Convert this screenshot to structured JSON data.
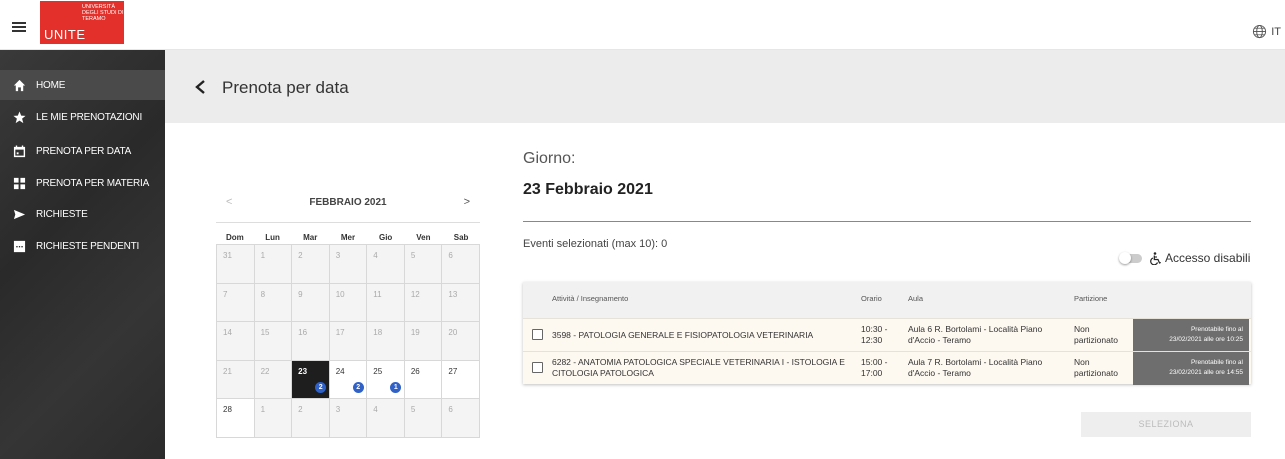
{
  "header": {
    "logo_text": "UNITE",
    "logo_subtext": "UNIVERSITÀ DEGLI STUDI DI TERAMO",
    "language": "IT"
  },
  "sidebar": {
    "items": [
      {
        "label": "HOME",
        "icon": "home-icon"
      },
      {
        "label": "LE MIE PRENOTAZIONI",
        "icon": "star-icon"
      },
      {
        "label": "PRENOTA PER DATA",
        "icon": "calendar-icon"
      },
      {
        "label": "PRENOTA PER MATERIA",
        "icon": "grid-icon"
      },
      {
        "label": "RICHIESTE",
        "icon": "send-icon"
      },
      {
        "label": "RICHIESTE PENDENTI",
        "icon": "pending-icon"
      }
    ]
  },
  "page": {
    "title": "Prenota per data"
  },
  "calendar": {
    "month": "FEBBRAIO 2021",
    "prev": "<",
    "next": ">",
    "days_of_week": [
      "Dom",
      "Lun",
      "Mar",
      "Mer",
      "Gio",
      "Ven",
      "Sab"
    ],
    "weeks": [
      [
        "31",
        "1",
        "2",
        "3",
        "4",
        "5",
        "6"
      ],
      [
        "7",
        "8",
        "9",
        "10",
        "11",
        "12",
        "13"
      ],
      [
        "14",
        "15",
        "16",
        "17",
        "18",
        "19",
        "20"
      ],
      [
        "21",
        "22",
        "23",
        "24",
        "25",
        "26",
        "27"
      ],
      [
        "28",
        "1",
        "2",
        "3",
        "4",
        "5",
        "6"
      ]
    ],
    "selected": "23",
    "badges": {
      "23": "2",
      "24": "2",
      "25": "1"
    }
  },
  "details": {
    "day_label": "Giorno:",
    "day_value": "23 Febbraio 2021",
    "selected_events": "Eventi selezionati (max 10): 0",
    "accessibility_label": "Accesso disabili"
  },
  "table": {
    "headers": {
      "activity": "Attività / Insegnamento",
      "time": "Orario",
      "room": "Aula",
      "partition": "Partizione"
    },
    "rows": [
      {
        "activity": "3598 - PATOLOGIA GENERALE E FISIOPATOLOGIA VETERINARIA",
        "time": "10:30 - 12:30",
        "room": "Aula 6 R. Bortolami - Località Piano d'Accio - Teramo",
        "partition": "Non partizionato",
        "book_line1": "Prenotabile fino al",
        "book_line2": "23/02/2021 alle ore 10:25"
      },
      {
        "activity": "6282 - ANATOMIA PATOLOGICA SPECIALE VETERINARIA I - ISTOLOGIA E CITOLOGIA PATOLOGICA",
        "time": "15:00 - 17:00",
        "room": "Aula 7 R. Bortolami - Località Piano d'Accio - Teramo",
        "partition": "Non partizionato",
        "book_line1": "Prenotabile fino al",
        "book_line2": "23/02/2021 alle ore 14:55"
      }
    ]
  },
  "actions": {
    "select_label": "SELEZIONA"
  },
  "colors": {
    "brand_red": "#e3302a",
    "badge_blue": "#2f61c7",
    "sidebar_bg": "#2f2f2f"
  }
}
